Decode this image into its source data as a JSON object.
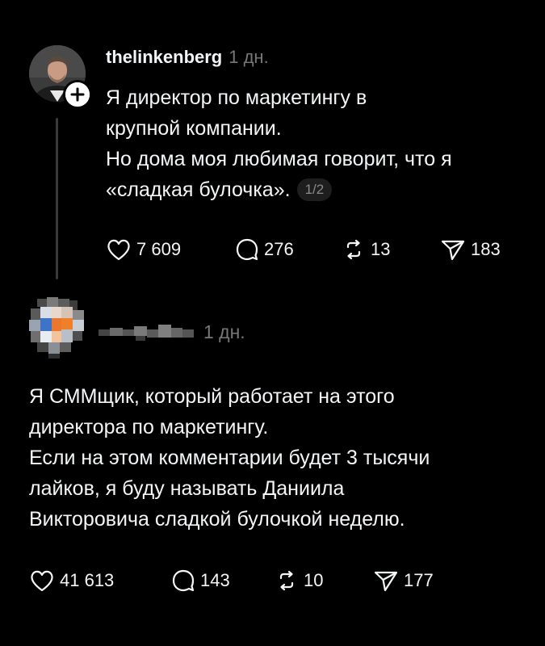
{
  "post1": {
    "username": "thelinkenberg",
    "time": "1 дн.",
    "text_lines": [
      "Я директор по маркетингу в",
      "крупной компании.",
      "Но дома моя любимая говорит, что я",
      "«сладкая булочка»."
    ],
    "page_indicator": "1/2",
    "actions": {
      "likes": "7 609",
      "comments": "276",
      "reposts": "13",
      "shares": "183"
    }
  },
  "post2": {
    "time": "1 дн.",
    "text_lines": [
      "Я СММщик, который работает на этого",
      "директора по маркетингу.",
      "Если на этом комментарии будет 3 тысячи",
      "лайков, я буду называть Даниила",
      "Викторовича сладкой булочкой неделю."
    ],
    "actions": {
      "likes": "41 613",
      "comments": "143",
      "reposts": "10",
      "shares": "177"
    }
  },
  "icons": {
    "like": "heart-icon",
    "comment": "comment-bubble-icon",
    "repost": "repost-icon",
    "share": "send-icon",
    "follow": "plus-icon"
  },
  "colors": {
    "background": "#000000",
    "text": "#f3f5f7",
    "muted": "#777777"
  }
}
